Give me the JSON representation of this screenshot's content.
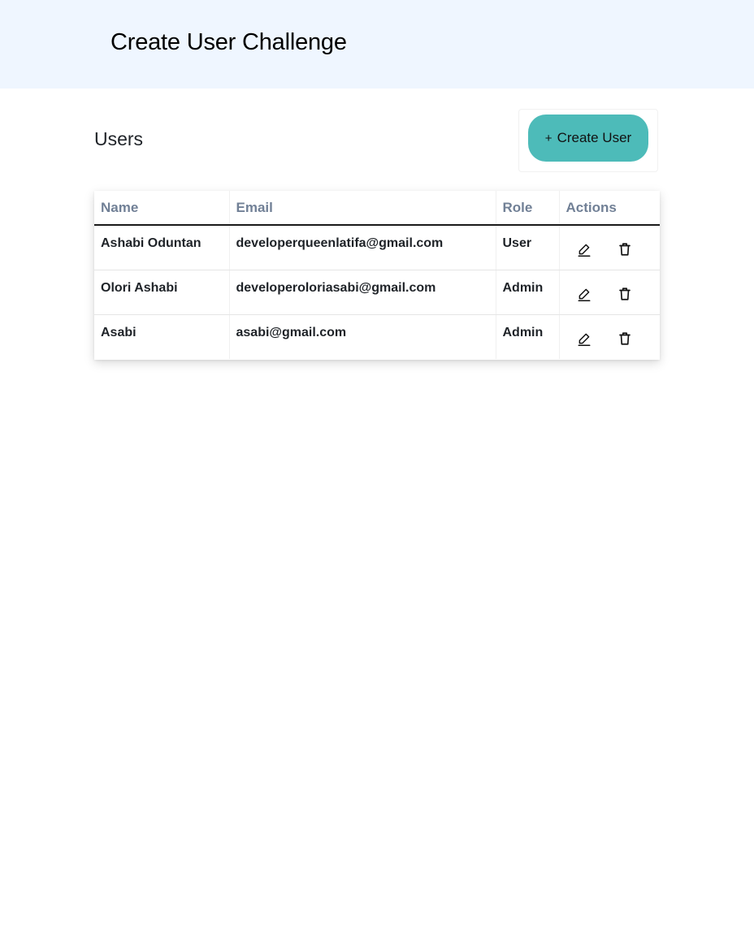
{
  "app": {
    "title": "Create User Challenge"
  },
  "users_section": {
    "title": "Users",
    "create_button": {
      "icon": "plus-icon",
      "icon_glyph": "+",
      "label": "Create User"
    }
  },
  "table": {
    "columns": [
      "Name",
      "Email",
      "Role",
      "Actions"
    ],
    "rows": [
      {
        "name": "Ashabi Oduntan",
        "email": "developerqueenlatifa@gmail.com",
        "role": "User"
      },
      {
        "name": "Olori Ashabi",
        "email": "developeroloriasabi@gmail.com",
        "role": "Admin"
      },
      {
        "name": "Asabi",
        "email": "asabi@gmail.com",
        "role": "Admin"
      }
    ],
    "row_actions": [
      "pencil-icon",
      "trash-icon"
    ]
  },
  "colors": {
    "header_bg": "#eff6ff",
    "accent": "#4dbbb9",
    "column_header_text": "#718096"
  }
}
